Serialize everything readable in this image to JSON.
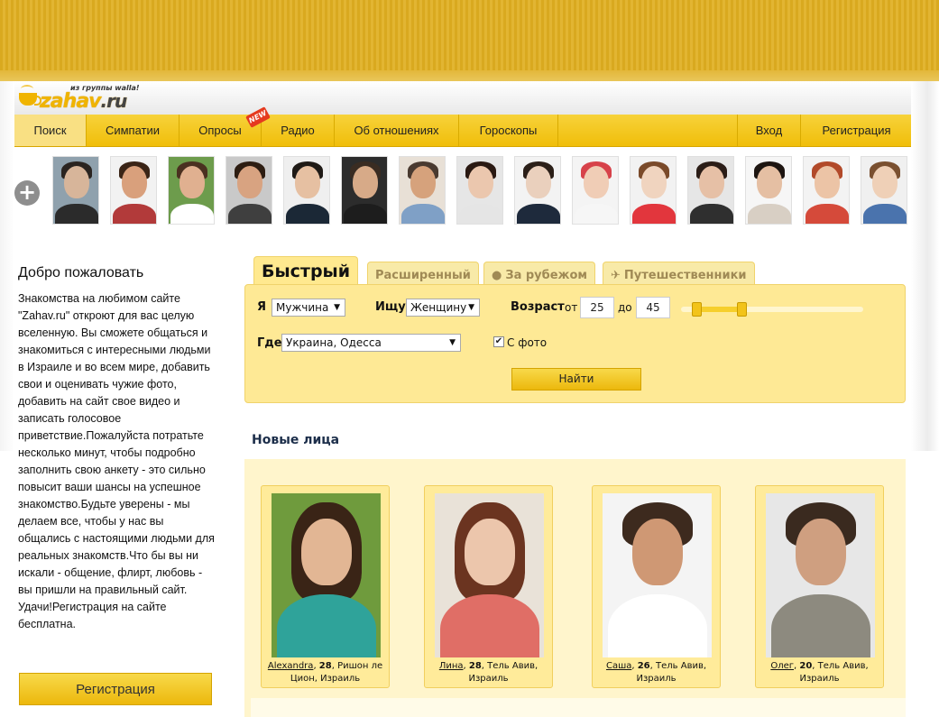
{
  "logo": {
    "wordmark_main": "zahav",
    "wordmark_tld": ".ru",
    "tagline": "из группы walla!"
  },
  "nav": {
    "items": [
      {
        "label": "Поиск"
      },
      {
        "label": "Симпатии"
      },
      {
        "label": "Опросы",
        "badge": "NEW"
      },
      {
        "label": "Радио"
      },
      {
        "label": "Об отношениях"
      },
      {
        "label": "Гороскопы"
      }
    ],
    "login_label": "Вход",
    "register_label": "Регистрация"
  },
  "faces_strip": {
    "add_icon": "plus-icon",
    "thumbs": [
      {
        "bg": "#8fa1ad",
        "skin": "#d7b59a",
        "hair": "#2a2420",
        "shirt": "#2b2b2b"
      },
      {
        "bg": "#f2f2f2",
        "skin": "#d9a07c",
        "hair": "#3a2416",
        "shirt": "#b23a3a"
      },
      {
        "bg": "#6d9c4c",
        "skin": "#e0b090",
        "hair": "#4a3020",
        "shirt": "#ffffff"
      },
      {
        "bg": "#c9c9c9",
        "skin": "#d8a381",
        "hair": "#2d1d12",
        "shirt": "#3f3f3f"
      },
      {
        "bg": "#efefef",
        "skin": "#e6c0a2",
        "hair": "#1f1a16",
        "shirt": "#1b2836"
      },
      {
        "bg": "#2c2c2c",
        "skin": "#d7aa88",
        "hair": "#3a2c22",
        "shirt": "#1d1d1d"
      },
      {
        "bg": "#e8e0d6",
        "skin": "#d6a27c",
        "hair": "#4a3a30",
        "shirt": "#7fa0c6"
      },
      {
        "bg": "#e6e6e6",
        "skin": "#ebc7ae",
        "hair": "#2a1912",
        "shirt": "#e5e5e5"
      },
      {
        "bg": "#f3f3f3",
        "skin": "#ead0bd",
        "hair": "#2b1f18",
        "shirt": "#1e2a3c"
      },
      {
        "bg": "#f4f4f4",
        "skin": "#f0cdb6",
        "hair": "#d7424a",
        "shirt": "#f6f6f6"
      },
      {
        "bg": "#f2f2f2",
        "skin": "#f0d4bf",
        "hair": "#7a4a2a",
        "shirt": "#e2363d"
      },
      {
        "bg": "#e6e6e6",
        "skin": "#e6c0a6",
        "hair": "#2b1d17",
        "shirt": "#2f2f2f"
      },
      {
        "bg": "#f6f6f6",
        "skin": "#e5bfa3",
        "hair": "#1d1511",
        "shirt": "#d8cfc4"
      },
      {
        "bg": "#f3f3f3",
        "skin": "#ecc4a6",
        "hair": "#b24a2a",
        "shirt": "#d54a3a"
      },
      {
        "bg": "#f0f0f0",
        "skin": "#efd0b7",
        "hair": "#7a5030",
        "shirt": "#4a73ad"
      }
    ]
  },
  "welcome": {
    "title": "Добро пожаловать",
    "text": "Знакомства на любимом сайте \"Zahav.ru\" откроют для вас целую вселенную. Вы сможете общаться и знакомиться с интересными людьми в Израиле и во всем мире, добавить свои и оценивать чужие фото, добавить на сайт свое видео и записать голосовое приветствие.Пожалуйста потратьте несколько минут, чтобы подробно заполнить свою анкету - это сильно повысит ваши шансы на успешное знакомство.Будьте уверены - мы делаем все, чтобы у нас вы общались с настоящими людьми для реальных знакомств.Что бы вы ни искали - общение, флирт, любовь - вы пришли на правильный сайт. Удачи!Регистрация на сайте бесплатна.",
    "register_button": "Регистрация"
  },
  "search": {
    "tabs": [
      {
        "label": "Быстрый",
        "icon": ""
      },
      {
        "label": "Расширенный",
        "icon": ""
      },
      {
        "label": "За рубежом",
        "icon": "globe-icon"
      },
      {
        "label": "Путешественники",
        "icon": "airplane-icon"
      }
    ],
    "i_label": "Я",
    "i_value": "Мужчина",
    "seek_label": "Ищу",
    "seek_value": "Женщину",
    "age_label": "Возраст",
    "age_from_label": "от",
    "age_from": "25",
    "age_to_label": "до",
    "age_to": "45",
    "age_slider_range": [
      25,
      45
    ],
    "where_label": "Где",
    "where_value": "Украина, Одесса",
    "photo_label": "С фото",
    "photo_checked": true,
    "find_button": "Найти"
  },
  "new_faces": {
    "title": "Новые лица",
    "profiles": [
      {
        "name": "Alexandra",
        "age": "28",
        "location": "Ришон ле Цион, Израиль",
        "colors": {
          "bg": "#6f9b3d",
          "hair": "#3a2416",
          "skin": "#e2b694",
          "top": "#2fa39a"
        }
      },
      {
        "name": "Лина",
        "age": "28",
        "location": "Тель Авив, Израиль",
        "colors": {
          "bg": "#e9e2d8",
          "hair": "#6b3420",
          "skin": "#ecc6ac",
          "top": "#e06e66"
        }
      },
      {
        "name": "Саша",
        "age": "26",
        "location": "Тель Авив, Израиль",
        "colors": {
          "bg": "#f4f4f4",
          "hair": "#3d2a1e",
          "skin": "#cf9874",
          "top": "#ffffff"
        }
      },
      {
        "name": "Олег",
        "age": "20",
        "location": "Тель Авив, Израиль",
        "colors": {
          "bg": "#e7e7e7",
          "hair": "#3a2a1f",
          "skin": "#cf9f80",
          "top": "#8d8a7f"
        }
      }
    ]
  }
}
